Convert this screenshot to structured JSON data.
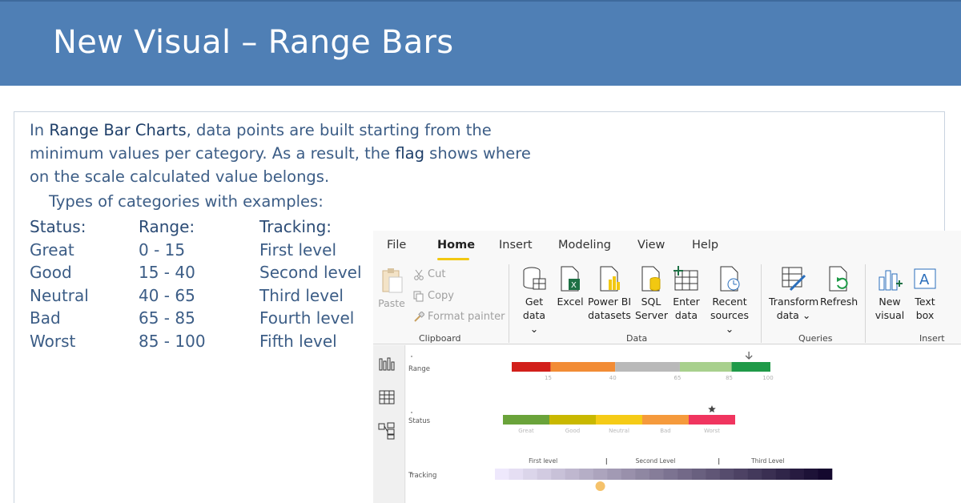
{
  "slide": {
    "title": "New Visual – Range Bars",
    "intro": {
      "l1_pre": "In ",
      "l1_bold": "Range Bar Charts",
      "l1_post": ", data points are built starting from the",
      "l2": "minimum values per category. As a result, the ",
      "l2_bold": "flag",
      "l2_post": " shows where",
      "l3": "on the scale calculated value belongs.",
      "types": "Types of categories with examples:"
    },
    "columns": [
      {
        "header": "Status:",
        "items": [
          "Great",
          "Good",
          "Neutral",
          "Bad",
          "Worst"
        ]
      },
      {
        "header": "Range:",
        "items": [
          "0 - 15",
          "15 - 40",
          "40 - 65",
          "65 - 85",
          "85 - 100"
        ]
      },
      {
        "header": "Tracking:",
        "items": [
          "First level",
          "Second level",
          "Third level",
          "Fourth level",
          "Fifth level"
        ]
      }
    ]
  },
  "pbi": {
    "menu": [
      "File",
      "Home",
      "Insert",
      "Modeling",
      "View",
      "Help"
    ],
    "active_tab": "Home",
    "clipboard": {
      "paste": "Paste",
      "cut": "Cut",
      "copy": "Copy",
      "format_painter": "Format painter",
      "group": "Clipboard"
    },
    "data": {
      "get_data_1": "Get",
      "get_data_2": "data ⌄",
      "excel": "Excel",
      "powerbi_1": "Power BI",
      "powerbi_2": "datasets",
      "sql_1": "SQL",
      "sql_2": "Server",
      "enter_1": "Enter",
      "enter_2": "data",
      "recent_1": "Recent",
      "recent_2": "sources ⌄",
      "group": "Data"
    },
    "queries": {
      "transform_1": "Transform",
      "transform_2": "data ⌄",
      "refresh": "Refresh",
      "group": "Queries"
    },
    "insert": {
      "new_visual_1": "New",
      "new_visual_2": "visual",
      "text_box_1": "Text",
      "text_box_2": "box",
      "group": "Insert"
    },
    "visuals": {
      "range": {
        "label": "Range",
        "bands": [
          {
            "from": 0,
            "to": 15,
            "color": "#d21f1a"
          },
          {
            "from": 15,
            "to": 40,
            "color": "#f28c35"
          },
          {
            "from": 40,
            "to": 65,
            "color": "#b9b9b9"
          },
          {
            "from": 65,
            "to": 85,
            "color": "#a8d08d"
          },
          {
            "from": 85,
            "to": 100,
            "color": "#1f9a48"
          }
        ],
        "ticks": [
          "15",
          "40",
          "65",
          "85",
          "100"
        ],
        "marker_value": 92,
        "marker_icon": "down-arrow-icon"
      },
      "status": {
        "label": "Status",
        "bands": [
          {
            "name": "Great",
            "color": "#6aa33a"
          },
          {
            "name": "Good",
            "color": "#c9b800"
          },
          {
            "name": "Neutral",
            "color": "#f5cb16"
          },
          {
            "name": "Bad",
            "color": "#f59a3c"
          },
          {
            "name": "Worst",
            "color": "#f0355f"
          }
        ],
        "marker_band": "Worst",
        "marker_icon": "star-icon"
      },
      "tracking": {
        "label": "Tracking",
        "level_labels": [
          "First level",
          "Second Level",
          "Third Level"
        ],
        "cells": 24,
        "marker_cell": 7
      }
    }
  }
}
